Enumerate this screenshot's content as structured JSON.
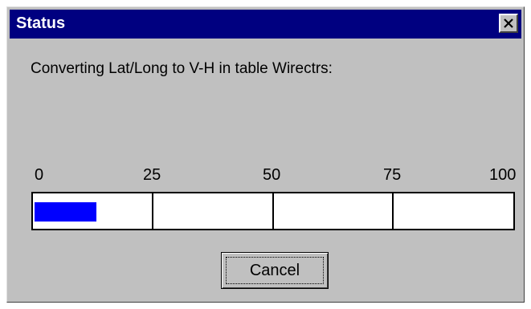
{
  "window": {
    "title": "Status",
    "close_icon": "close-icon"
  },
  "message": "Converting Lat/Long to V-H in table Wirectrs:",
  "progress": {
    "scale_labels": [
      "0",
      "25",
      "50",
      "75",
      "100"
    ],
    "value_percent": 13,
    "fill_color": "#0000ff"
  },
  "buttons": {
    "cancel_label": "Cancel"
  },
  "colors": {
    "titlebar": "#000080",
    "dialog_bg": "#c0c0c0"
  }
}
